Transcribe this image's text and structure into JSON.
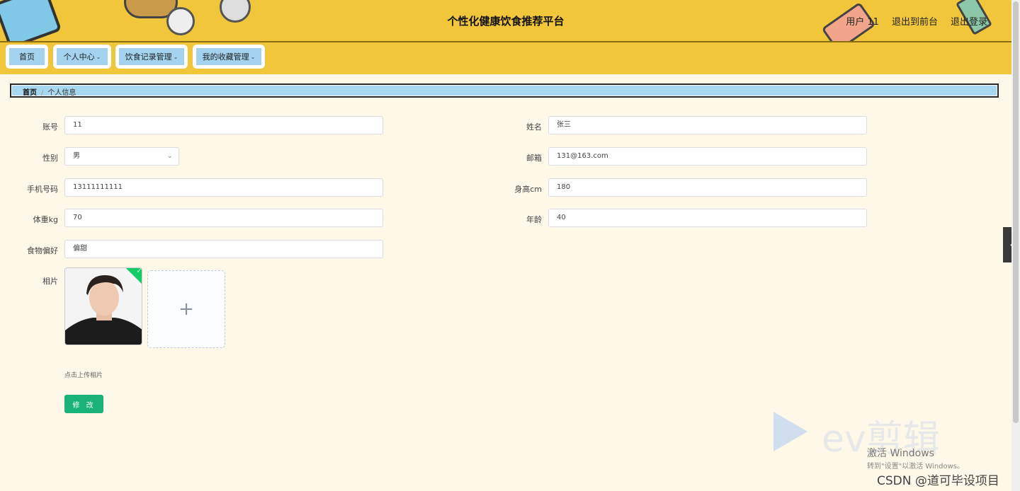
{
  "header": {
    "title": "个性化健康饮食推荐平台",
    "user": "用户 11",
    "exit_front": "退出到前台",
    "logout": "退出登录"
  },
  "nav": {
    "items": [
      {
        "label": "首页"
      },
      {
        "label": "个人中心"
      },
      {
        "label": "饮食记录管理"
      },
      {
        "label": "我的收藏管理"
      }
    ]
  },
  "breadcrumb": {
    "home": "首页",
    "separator": "/",
    "current": "个人信息"
  },
  "form": {
    "account": {
      "label": "账号",
      "value": "11"
    },
    "name": {
      "label": "姓名",
      "value": "张三"
    },
    "gender": {
      "label": "性别",
      "value": "男"
    },
    "email": {
      "label": "邮箱",
      "value": "131@163.com"
    },
    "phone": {
      "label": "手机号码",
      "value": "13111111111"
    },
    "height": {
      "label": "身高cm",
      "value": "180"
    },
    "weight": {
      "label": "体重kg",
      "value": "70"
    },
    "age": {
      "label": "年龄",
      "value": "40"
    },
    "food_pref": {
      "label": "食物偏好",
      "value": "偏甜"
    },
    "photo": {
      "label": "相片",
      "hint": "点击上传相片"
    },
    "submit_label": "修 改"
  },
  "watermarks": {
    "ev": "ev剪辑",
    "win_line1": "激活 Windows",
    "win_line2": "转到\"设置\"以激活 Windows。",
    "csdn": "CSDN @道可毕设项目"
  },
  "colors": {
    "header_bg": "#f2c63a",
    "nav_btn": "#a3d3ee",
    "primary_btn": "#19b37a"
  }
}
